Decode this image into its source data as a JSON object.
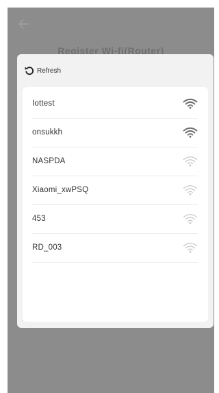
{
  "header": {
    "title": "Register Wi-fi(Router)",
    "back_icon": "arrow-left-icon"
  },
  "sheet": {
    "refresh_label": "Refresh",
    "refresh_icon": "refresh-icon"
  },
  "networks": [
    {
      "ssid": "Iottest",
      "signal": "strong"
    },
    {
      "ssid": "onsukkh",
      "signal": "strong"
    },
    {
      "ssid": "NASPDA",
      "signal": "weak"
    },
    {
      "ssid": "Xiaomi_xwPSQ",
      "signal": "weak"
    },
    {
      "ssid": "453",
      "signal": "weak"
    },
    {
      "ssid": "RD_003",
      "signal": "weak"
    }
  ],
  "colors": {
    "overlay": "#8c8c8c",
    "sheet_bg": "#f2f2f2",
    "list_bg": "#ffffff",
    "wifi_strong": "#6a6a6a",
    "wifi_weak": "#c8c8c8"
  }
}
